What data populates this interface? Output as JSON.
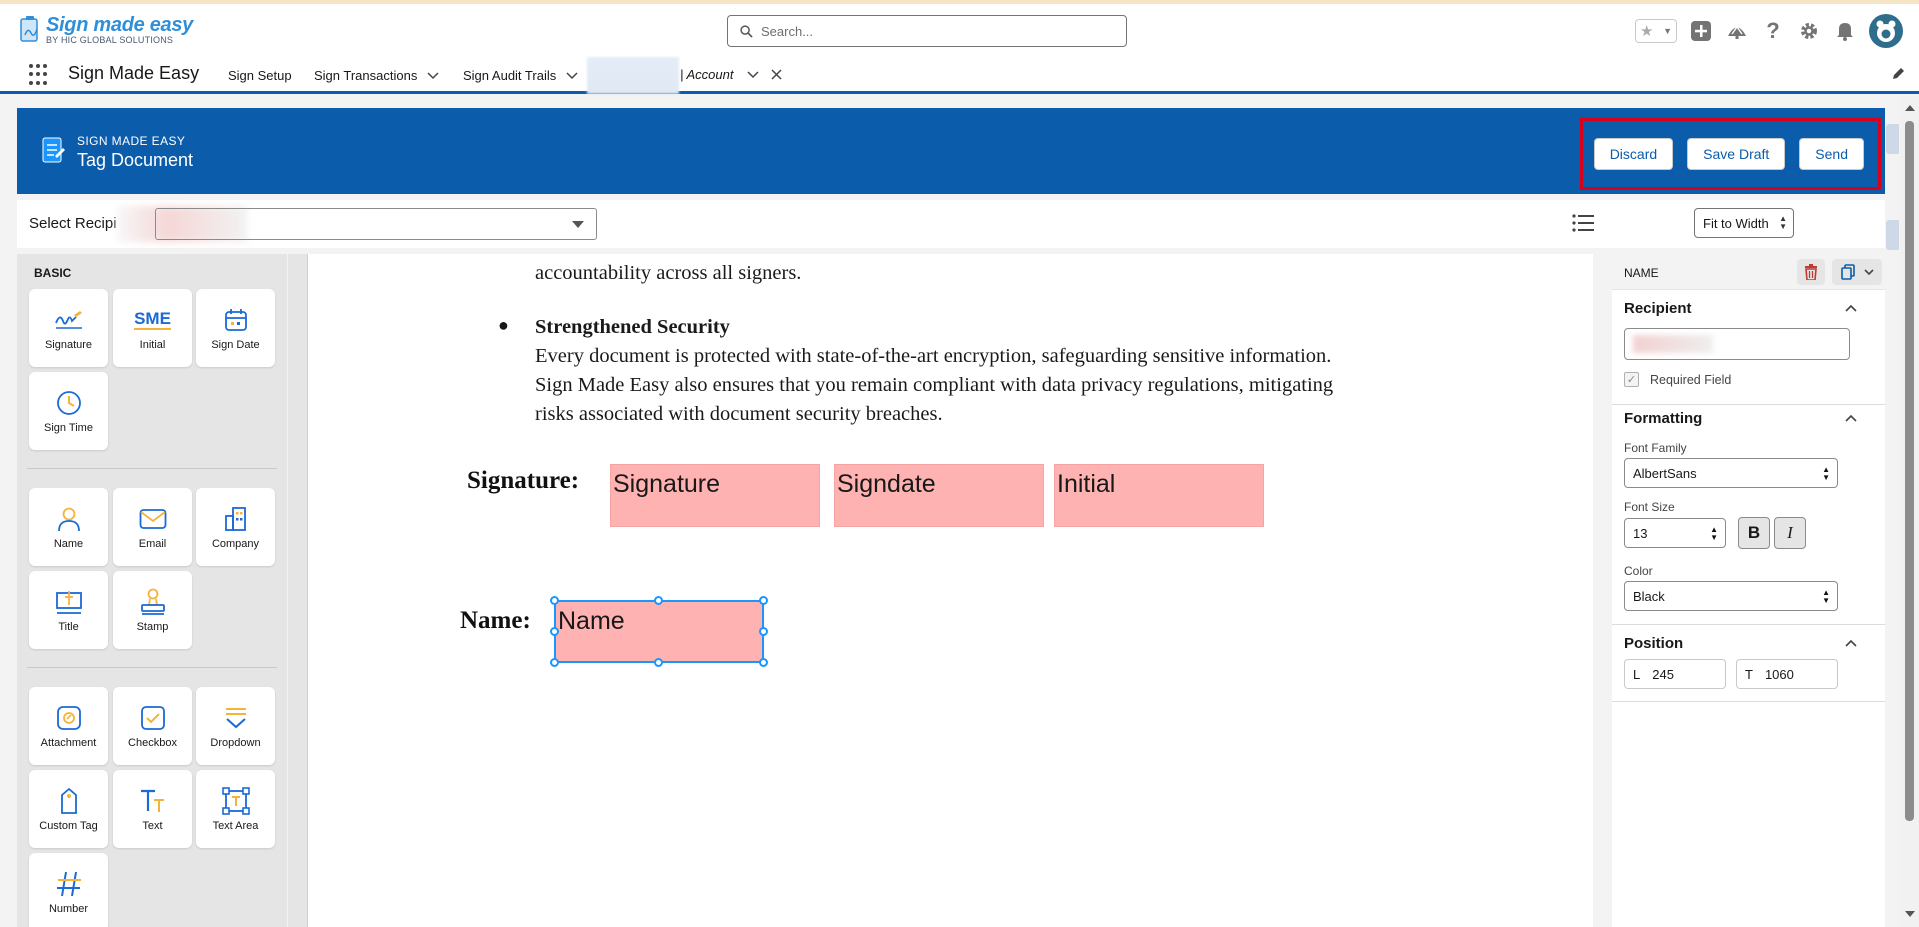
{
  "header": {
    "logo_title": "Sign made easy",
    "logo_sub": "BY HIC GLOBAL SOLUTIONS",
    "search_placeholder": "Search..."
  },
  "nav": {
    "app_name": "Sign Made Easy",
    "items": [
      {
        "label": "Sign Setup",
        "has_menu": false
      },
      {
        "label": "Sign Transactions",
        "has_menu": true
      },
      {
        "label": "Sign Audit Trails",
        "has_menu": true
      }
    ],
    "active_tab": "| Account"
  },
  "page": {
    "eyebrow": "SIGN MADE EASY",
    "title": "Tag Document",
    "actions": {
      "discard": "Discard",
      "save_draft": "Save Draft",
      "send": "Send"
    },
    "recipient_label": "Select Recipi",
    "zoom": "Fit to Width"
  },
  "palette": {
    "basic_title": "BASIC",
    "basic": [
      "Signature",
      "Initial",
      "Sign Date",
      "Sign Time"
    ],
    "initial_icon_text": "SME",
    "info": [
      "Name",
      "Email",
      "Company",
      "Title",
      "Stamp"
    ],
    "inputs": [
      "Attachment",
      "Checkbox",
      "Dropdown",
      "Custom Tag",
      "Text",
      "Text Area",
      "Number"
    ]
  },
  "document": {
    "line_prev": "accountability across all signers.",
    "bullet_title": "Strengthened Security",
    "bullet_lines": [
      "Every document is protected with state-of-the-art encryption, safeguarding sensitive information.",
      "Sign Made Easy also ensures that you remain compliant with data privacy regulations, mitigating",
      "risks associated with document security breaches."
    ],
    "signature_label": "Signature:",
    "name_label": "Name:",
    "fields": {
      "signature": "Signature",
      "signdate": "Signdate",
      "initial": "Initial",
      "name": "Name"
    }
  },
  "props": {
    "field_type": "NAME",
    "recipient_title": "Recipient",
    "required_label": "Required Field",
    "required_checked": true,
    "formatting_title": "Formatting",
    "font_family_label": "Font Family",
    "font_family": "AlbertSans",
    "font_size_label": "Font Size",
    "font_size": "13",
    "bold": "B",
    "italic": "I",
    "color_label": "Color",
    "color": "Black",
    "position_title": "Position",
    "pos_l_label": "L",
    "pos_l": "245",
    "pos_t_label": "T",
    "pos_t": "1060"
  },
  "colors": {
    "brand_blue": "#0b5cab",
    "field_pink": "#ffb2b2",
    "highlight_red": "#d9001b",
    "select_blue": "#1b96ff"
  }
}
